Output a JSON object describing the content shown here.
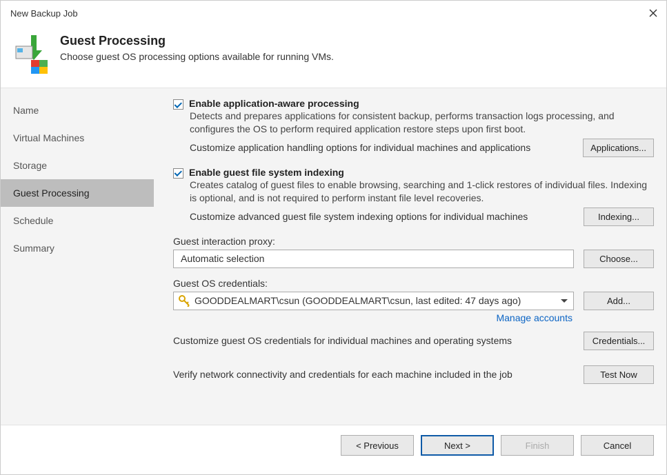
{
  "window": {
    "title": "New Backup Job"
  },
  "header": {
    "title": "Guest Processing",
    "subtitle": "Choose guest OS processing options available for running VMs."
  },
  "sidebar": {
    "items": [
      {
        "label": "Name"
      },
      {
        "label": "Virtual Machines"
      },
      {
        "label": "Storage"
      },
      {
        "label": "Guest Processing"
      },
      {
        "label": "Schedule"
      },
      {
        "label": "Summary"
      }
    ],
    "active_index": 3
  },
  "content": {
    "app_aware": {
      "checked": true,
      "label": "Enable application-aware processing",
      "desc": "Detects and prepares applications for consistent backup, performs transaction logs processing, and configures the OS to perform required application restore steps upon first boot.",
      "customize_text": "Customize application handling options for individual machines and applications",
      "button": "Applications..."
    },
    "indexing": {
      "checked": true,
      "label": "Enable guest file system indexing",
      "desc": "Creates catalog of guest files to enable browsing, searching and 1-click restores of individual files. Indexing is optional, and is not required to perform instant file level recoveries.",
      "customize_text": "Customize advanced guest file system indexing options for individual machines",
      "button": "Indexing..."
    },
    "proxy": {
      "label": "Guest interaction proxy:",
      "value": "Automatic selection",
      "button": "Choose..."
    },
    "credentials": {
      "label": "Guest OS credentials:",
      "value": "GOODDEALMART\\csun (GOODDEALMART\\csun, last edited: 47 days ago)",
      "button": "Add...",
      "manage_link": "Manage accounts",
      "customize_text": "Customize guest OS credentials for individual machines and operating systems",
      "customize_button": "Credentials..."
    },
    "verify": {
      "text": "Verify network connectivity and credentials for each machine included in the job",
      "button": "Test Now"
    }
  },
  "footer": {
    "previous": "< Previous",
    "next": "Next >",
    "finish": "Finish",
    "cancel": "Cancel"
  }
}
